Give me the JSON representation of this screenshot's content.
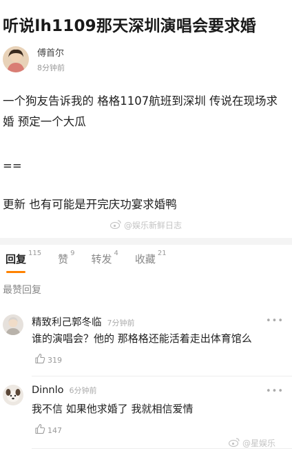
{
  "post": {
    "title": "听说lh1109那天深圳演唱会要求婚",
    "author_name": "傅首尔",
    "author_time": "8分钟前",
    "paragraphs": [
      "一个狗友告诉我的 格格1107航班到深圳 传说在现场求婚 预定一个大瓜",
      "==",
      "更新 也有可能是开完庆功宴求婚鸭"
    ],
    "watermark_mid": "@娱乐新鲜日志",
    "watermark_bottom": "@星娱乐"
  },
  "tabs": [
    {
      "label": "回复",
      "count": "115",
      "active": true
    },
    {
      "label": "赞",
      "count": "9",
      "active": false
    },
    {
      "label": "转发",
      "count": "4",
      "active": false
    },
    {
      "label": "收藏",
      "count": "21",
      "active": false
    }
  ],
  "section_label": "最赞回复",
  "comments": [
    {
      "name": "精致利己郭冬临",
      "time": "7分钟前",
      "text": "谁的演唱会？他的 那格格还能活着走出体育馆么",
      "likes": "319"
    },
    {
      "name": "Dinnlo",
      "time": "6分钟前",
      "text": "我不信 如果他求婚了 我就相信爱情",
      "likes": "147"
    }
  ],
  "icons": {
    "more": "more-dots-icon",
    "like": "thumbs-up-icon",
    "watermark": "weibo-logo-icon"
  },
  "colors": {
    "accent": "#ff8200"
  }
}
